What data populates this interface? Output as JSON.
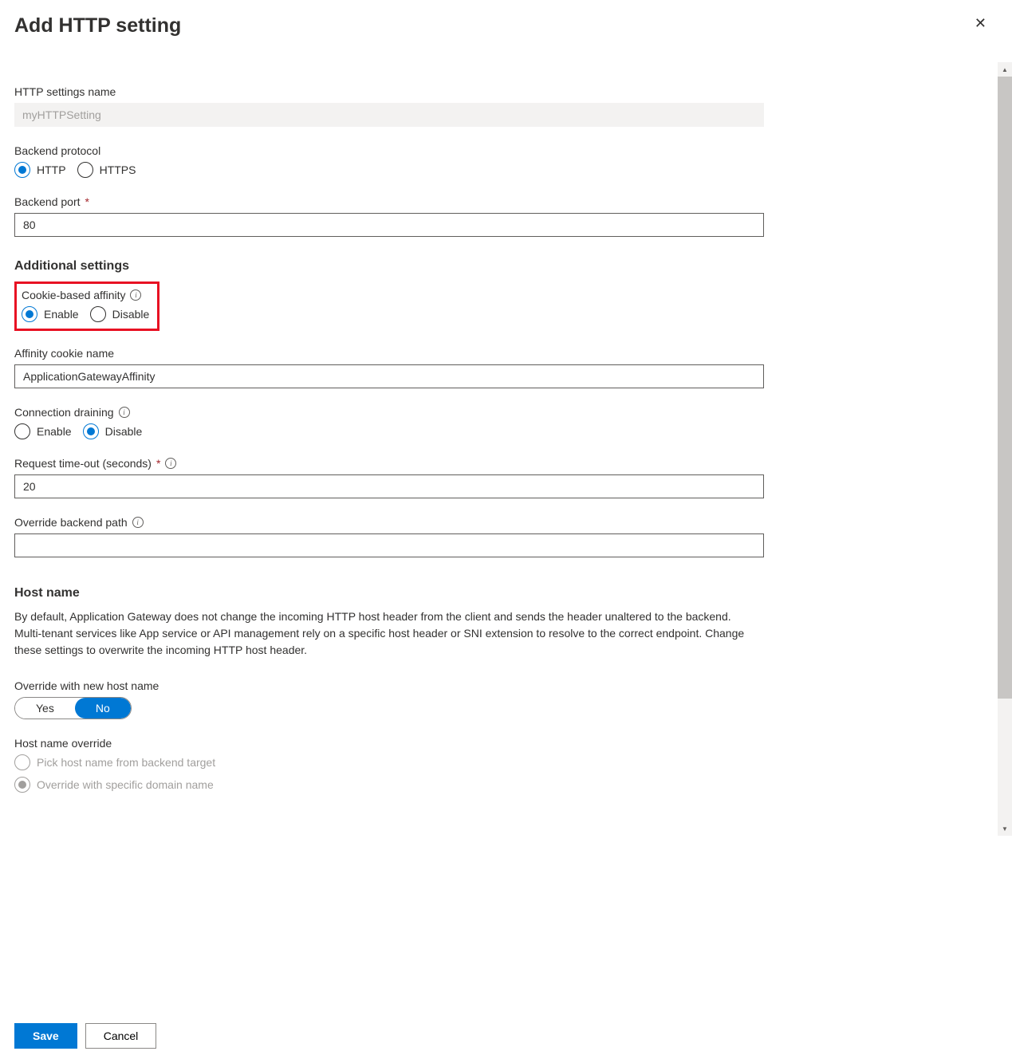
{
  "header": {
    "title": "Add HTTP setting"
  },
  "fields": {
    "name_label": "HTTP settings name",
    "name_value": "myHTTPSetting",
    "backend_protocol_label": "Backend protocol",
    "protocol_http": "HTTP",
    "protocol_https": "HTTPS",
    "backend_port_label": "Backend port",
    "backend_port_value": "80",
    "additional_settings_title": "Additional settings",
    "cookie_affinity_label": "Cookie-based affinity",
    "enable": "Enable",
    "disable": "Disable",
    "affinity_cookie_label": "Affinity cookie name",
    "affinity_cookie_value": "ApplicationGatewayAffinity",
    "connection_drain_label": "Connection draining",
    "request_timeout_label": "Request time-out (seconds)",
    "request_timeout_value": "20",
    "override_path_label": "Override backend path",
    "override_path_value": "",
    "hostname_title": "Host name",
    "hostname_desc": "By default, Application Gateway does not change the incoming HTTP host header from the client and sends the header unaltered to the backend. Multi-tenant services like App service or API management rely on a specific host header or SNI extension to resolve to the correct endpoint. Change these settings to overwrite the incoming HTTP host header.",
    "override_newhost_label": "Override with new host name",
    "yes": "Yes",
    "no": "No",
    "hostname_override_label": "Host name override",
    "pick_from_backend": "Pick host name from backend target",
    "override_specific": "Override with specific domain name"
  },
  "footer": {
    "save": "Save",
    "cancel": "Cancel"
  }
}
